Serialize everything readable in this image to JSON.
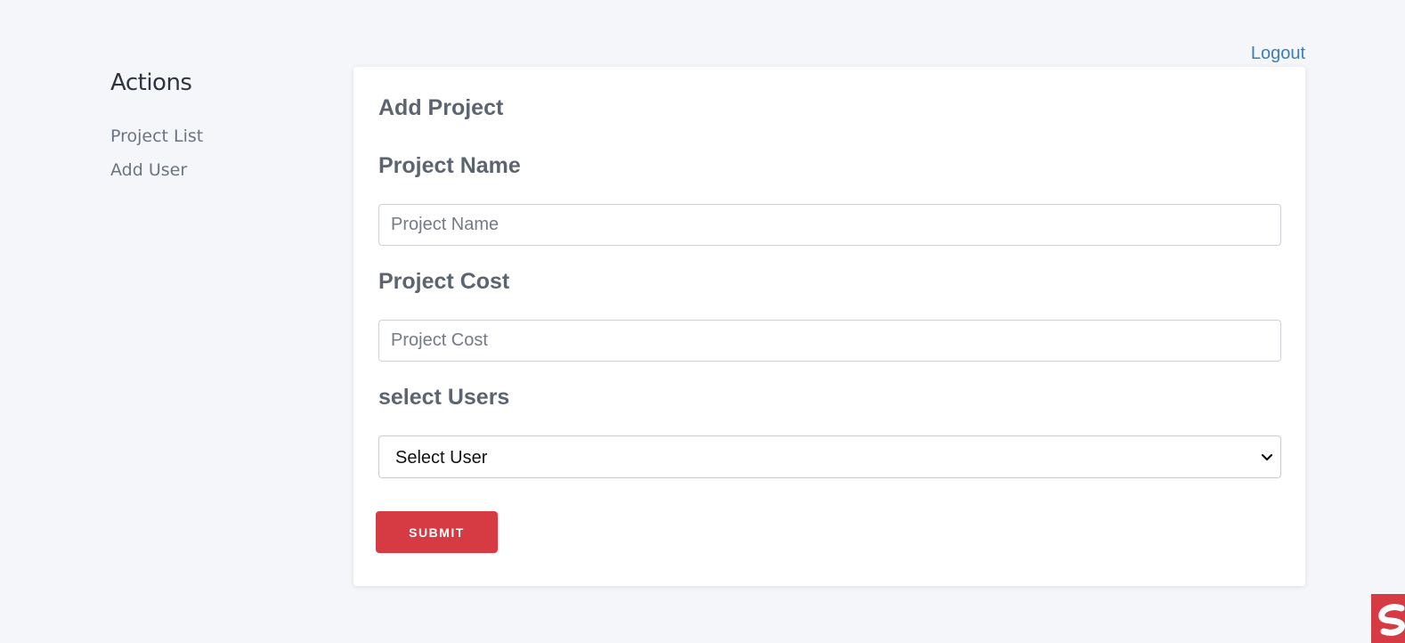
{
  "header": {
    "logout_label": "Logout"
  },
  "sidebar": {
    "title": "Actions",
    "items": [
      {
        "label": "Project List"
      },
      {
        "label": "Add User"
      }
    ]
  },
  "form": {
    "title": "Add Project",
    "project_name": {
      "label": "Project Name",
      "placeholder": "Project Name",
      "value": ""
    },
    "project_cost": {
      "label": "Project Cost",
      "placeholder": "Project Cost",
      "value": ""
    },
    "users": {
      "label": "select Users",
      "selected": "Select User"
    },
    "submit_label": "SUBMIT"
  },
  "icons": {
    "select_chevron": "chevron-down-icon",
    "corner_badge": "app-logo-icon"
  },
  "colors": {
    "accent": "#d63b44",
    "link": "#3b7fb8",
    "background": "#f5f6fa"
  }
}
